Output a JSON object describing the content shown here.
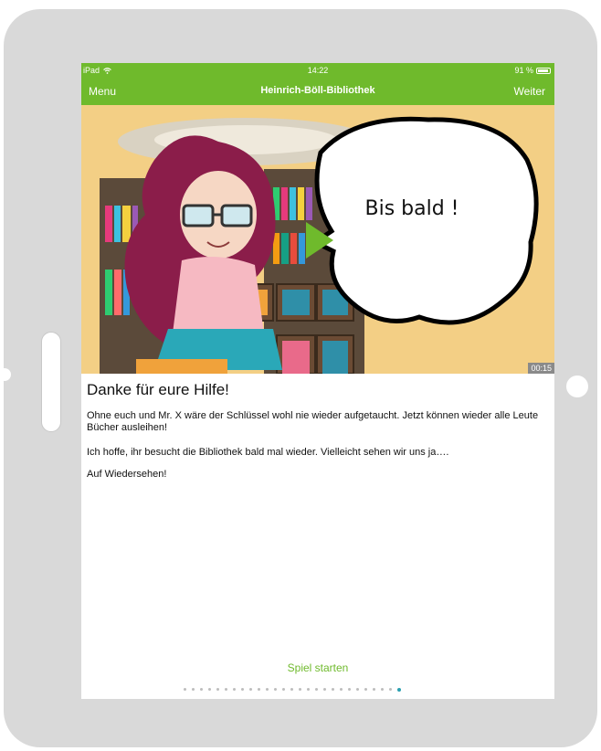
{
  "statusbar": {
    "device": "iPad",
    "time": "14:22",
    "battery": "91 %"
  },
  "navbar": {
    "left": "Menu",
    "title": "Heinrich-Böll-Bibliothek",
    "right": "Weiter"
  },
  "scene": {
    "speech": "Bis bald !",
    "timestamp": "00:15"
  },
  "content": {
    "heading": "Danke für eure Hilfe!",
    "paragraphs": [
      "Ohne euch und Mr. X wäre der Schlüssel wohl nie wieder aufgetaucht. Jetzt können wieder alle Leute Bücher ausleihen!",
      "Ich hoffe, ihr besucht die Bibliothek bald mal wieder. Vielleicht sehen wir uns ja….",
      "Auf Wiedersehen!"
    ]
  },
  "footer": {
    "start": "Spiel starten",
    "page_count": 27,
    "active_page": 27
  },
  "colors": {
    "accent": "#6fba2c",
    "page_dot_active": "#2a9fb0"
  }
}
